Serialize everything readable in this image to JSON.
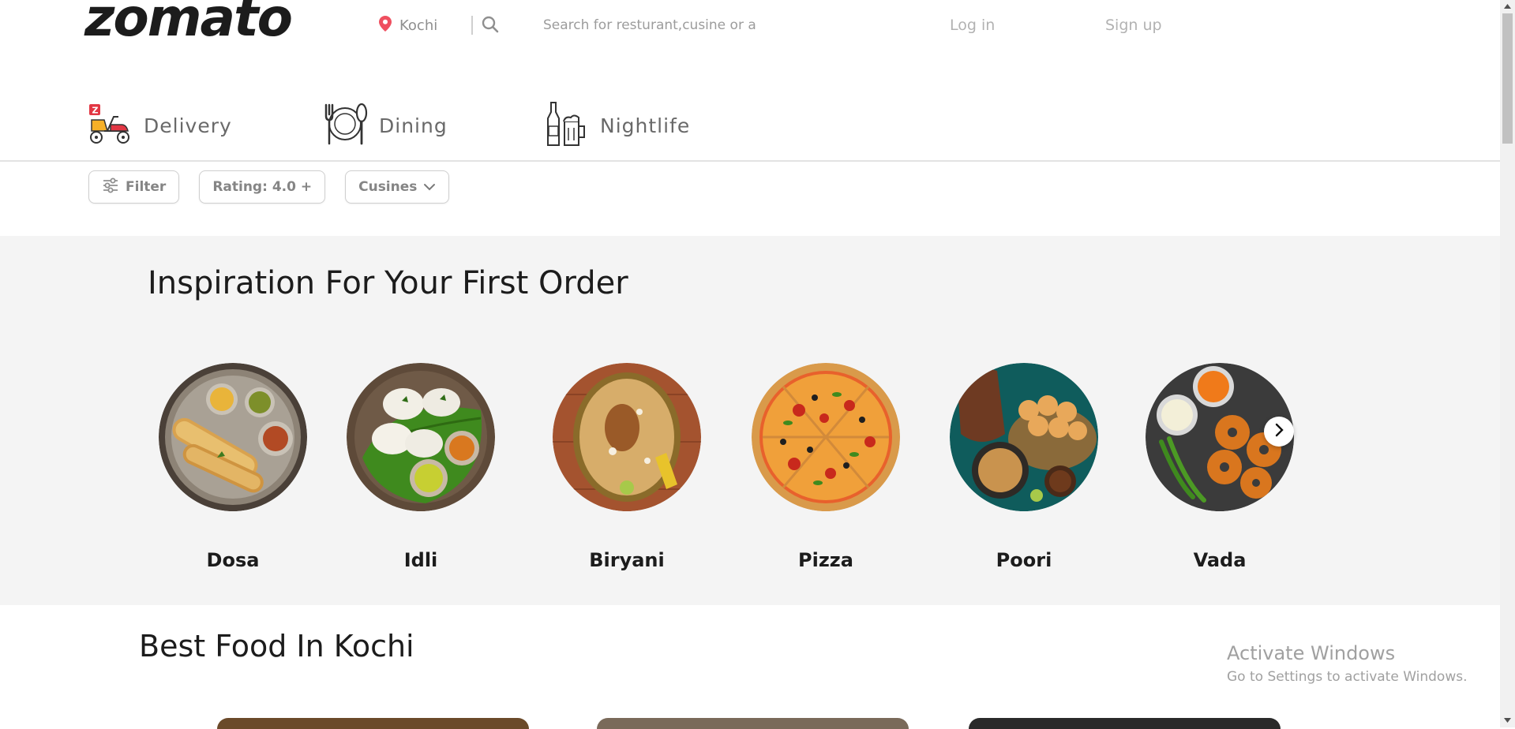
{
  "header": {
    "logo_text": "zomato",
    "location": "Kochi",
    "search_placeholder": "Search for resturant,cusine or a",
    "login_label": "Log in",
    "signup_label": "Sign up"
  },
  "tabs": [
    {
      "label": "Delivery",
      "icon": "delivery-scooter-icon"
    },
    {
      "label": "Dining",
      "icon": "plate-cutlery-icon"
    },
    {
      "label": "Nightlife",
      "icon": "bottle-mug-icon"
    }
  ],
  "filters": {
    "filter_label": "Filter",
    "rating_label": "Rating: 4.0 +",
    "cuisines_label": "Cusines"
  },
  "inspiration": {
    "title": "Inspiration For Your First Order",
    "items": [
      {
        "label": "Dosa"
      },
      {
        "label": "Idli"
      },
      {
        "label": "Biryani"
      },
      {
        "label": "Pizza"
      },
      {
        "label": "Poori"
      },
      {
        "label": "Vada"
      }
    ]
  },
  "best_food": {
    "title": "Best Food In Kochi"
  },
  "os_watermark": {
    "line1": "Activate Windows",
    "line2": "Go to Settings to activate Windows."
  },
  "colors": {
    "brand_text": "#1c1c1c",
    "location_pin": "#ef4f5f",
    "grey_section": "#f4f4f4"
  }
}
